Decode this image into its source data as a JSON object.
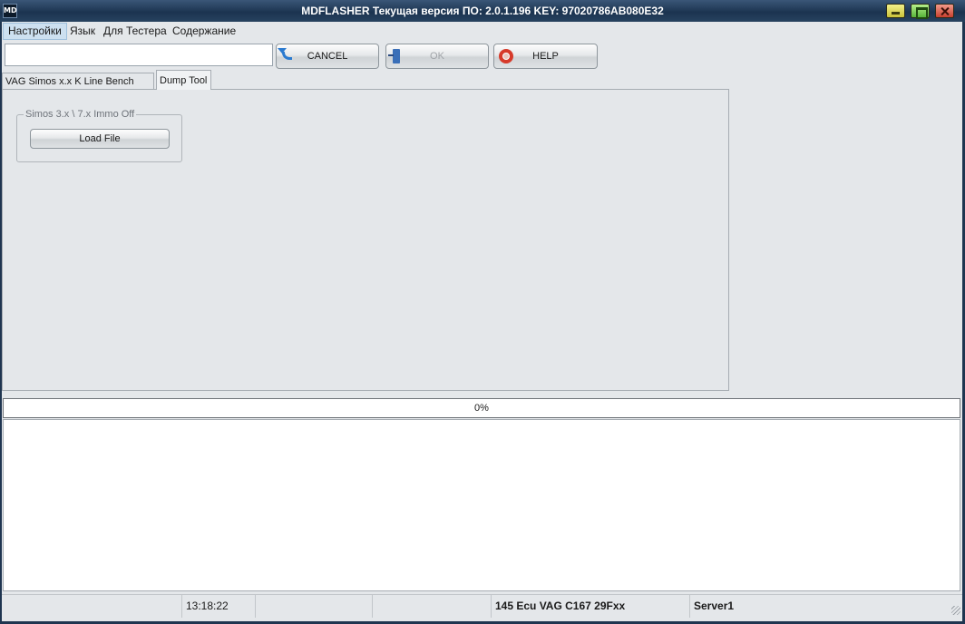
{
  "window": {
    "title": "MDFLASHER  Текущая версия ПО: 2.0.1.196  KEY: 97020786AB080E32",
    "icon": "app-logo-icon"
  },
  "menu": {
    "items": [
      "Настройки",
      "Язык",
      "Для Тестера",
      "Содержание"
    ],
    "active_index": 0
  },
  "toolbar": {
    "input_value": "",
    "cancel_label": "CANCEL",
    "ok_label": "OK",
    "help_label": "HELP"
  },
  "tabs": [
    {
      "label": "VAG Simos x.x K Line Bench Mode",
      "active": false
    },
    {
      "label": "Dump Tool",
      "active": true
    }
  ],
  "dump_tool": {
    "group_title": "Simos 3.x \\ 7.x Immo Off",
    "load_button": "Load File"
  },
  "progress": {
    "value": 0,
    "text": "0%"
  },
  "status": {
    "cells": [
      "",
      "13:18:22",
      "",
      "",
      "145 Ecu VAG C167 29Fxx",
      "Server1"
    ]
  },
  "colors": {
    "titlebar": "#223b58",
    "client_bg": "#e4e7ea",
    "menu_active": "#cde0f0"
  }
}
